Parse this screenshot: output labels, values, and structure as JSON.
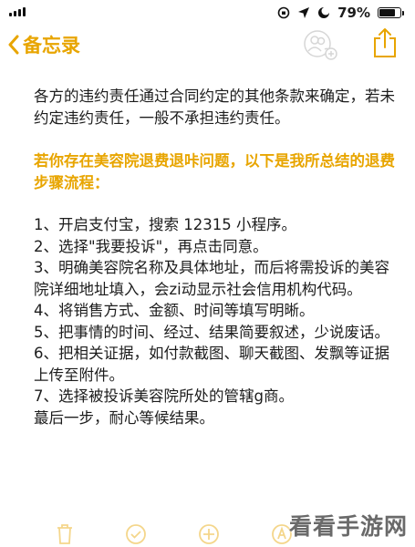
{
  "status_bar": {
    "battery_text": "79%",
    "battery_level": 0.79
  },
  "nav": {
    "back_label": "备忘录"
  },
  "note": {
    "paragraph1": "各方的违约责任通过合同约定的其他条款来确定，若未约定违约责任，一般不承担违约责任。",
    "highlight": "若你存在美容院退费退咔问题，以下是我所总结的退费步骤流程：",
    "steps": [
      "1、开启支付宝，搜索 12315 小程序。",
      "2、选择\"我要投诉\"，再点击同意。",
      "3、明确美容院名称及具体地址，而后将需投诉的美容院详细地址填入，会zi动显示社会信用机构代码。",
      "4、将销售方式、金额、时间等填写明晰。",
      "5、把事情的时间、经过、结果简要叙述，少说废话。",
      "6、把相关证据，如付款截图、聊天截图、发飘等证据上传至附件。",
      "7、选择被投诉美容院所处的管辖g商。",
      "蕞后一步，耐心等候结果。"
    ]
  },
  "watermark": "看看手游网",
  "accent_color": "#e8a500"
}
